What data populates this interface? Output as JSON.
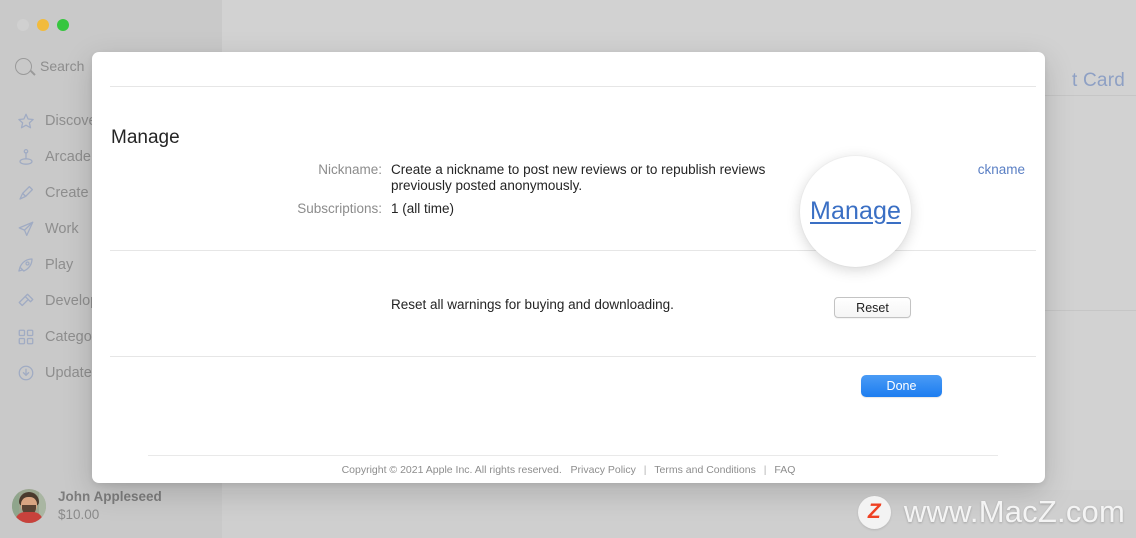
{
  "app": {
    "window_controls": [
      "close",
      "minimize",
      "maximize"
    ],
    "search": {
      "label": "Search",
      "icon": "search-icon"
    },
    "sidebar": {
      "items": [
        {
          "label": "Discover",
          "icon": "star-icon"
        },
        {
          "label": "Arcade",
          "icon": "joystick-icon"
        },
        {
          "label": "Create",
          "icon": "paintbrush-icon"
        },
        {
          "label": "Work",
          "icon": "paper-plane-icon"
        },
        {
          "label": "Play",
          "icon": "rocket-icon"
        },
        {
          "label": "Develop",
          "icon": "hammer-icon"
        },
        {
          "label": "Categories",
          "icon": "grid-icon"
        },
        {
          "label": "Updates",
          "icon": "download-icon"
        }
      ]
    },
    "account": {
      "name": "John Appleseed",
      "balance": "$10.00",
      "avatar": "user-photo"
    },
    "redeem_link": "t Card"
  },
  "modal": {
    "title": "Manage",
    "nickname": {
      "label": "Nickname:",
      "description": "Create a nickname to post new reviews or to republish reviews previously posted anonymously.",
      "action_link": "ckname"
    },
    "subscriptions": {
      "label": "Subscriptions:",
      "value": "1 (all time)"
    },
    "reset": {
      "description": "Reset all warnings for buying and downloading.",
      "button_label": "Reset"
    },
    "done_button": "Done",
    "footer": {
      "copyright": "Copyright © 2021 Apple Inc. All rights reserved.",
      "links": [
        "Privacy Policy",
        "Terms and Conditions",
        "FAQ"
      ],
      "separator": "|"
    }
  },
  "magnifier": {
    "link_label": "Manage"
  },
  "watermark": {
    "badge": "Z",
    "text": "www.MacZ.com"
  },
  "colors": {
    "accent_blue": "#1d7df0",
    "link_blue": "#5a7fc4",
    "magnifier_link": "#3a6fc4",
    "watermark_orange": "#ef4123",
    "sidebar_bg": "#c9c9c9"
  }
}
